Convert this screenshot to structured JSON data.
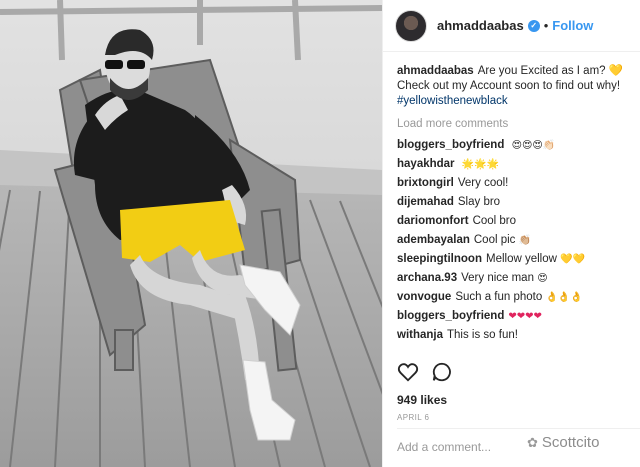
{
  "post": {
    "username": "ahmaddaabas",
    "dot": "•",
    "follow_label": "Follow",
    "caption_user": "ahmaddaabas",
    "caption_text": "Are you Excited as I am? 💛 Check out my Account soon to find out why!",
    "hashtag": "#yellowisthenewblack",
    "load_more": "Load more comments",
    "likes": "949 likes",
    "date": "APRIL 6",
    "add_comment_placeholder": "Add a comment..."
  },
  "comments": [
    {
      "user": "bloggers_boyfriend",
      "text": "",
      "emoji": "😍😍😍👏🏻"
    },
    {
      "user": "hayakhdar",
      "text": "",
      "emoji": "🌟🌟🌟"
    },
    {
      "user": "brixtongirl",
      "text": "Very cool!",
      "emoji": ""
    },
    {
      "user": "dijemahad",
      "text": "Slay bro",
      "emoji": ""
    },
    {
      "user": "dariomonfort",
      "text": "Cool bro",
      "emoji": ""
    },
    {
      "user": "adembayalan",
      "text": "Cool pic",
      "emoji": "👏🏼"
    },
    {
      "user": "sleepingtilnoon",
      "text": "Mellow yellow",
      "emoji": "💛💛"
    },
    {
      "user": "archana.93",
      "text": "Very nice man",
      "emoji": "😍"
    },
    {
      "user": "vonvogue",
      "text": "Such a fun photo",
      "emoji": "👌👌👌"
    },
    {
      "user": "bloggers_boyfriend",
      "text": "",
      "emoji": "❤❤❤❤"
    },
    {
      "user": "withanja",
      "text": "This is so fun!",
      "emoji": ""
    }
  ],
  "icons": {
    "verified": "verified-badge-icon",
    "like": "heart-icon",
    "comment": "comment-bubble-icon",
    "watermark": "wechat-icon"
  },
  "watermark": {
    "text": "Scottcito"
  },
  "colors": {
    "link_blue": "#3897f0",
    "hashtag": "#003569",
    "shorts_yellow": "#f2cd14",
    "muted_text": "#999999"
  }
}
